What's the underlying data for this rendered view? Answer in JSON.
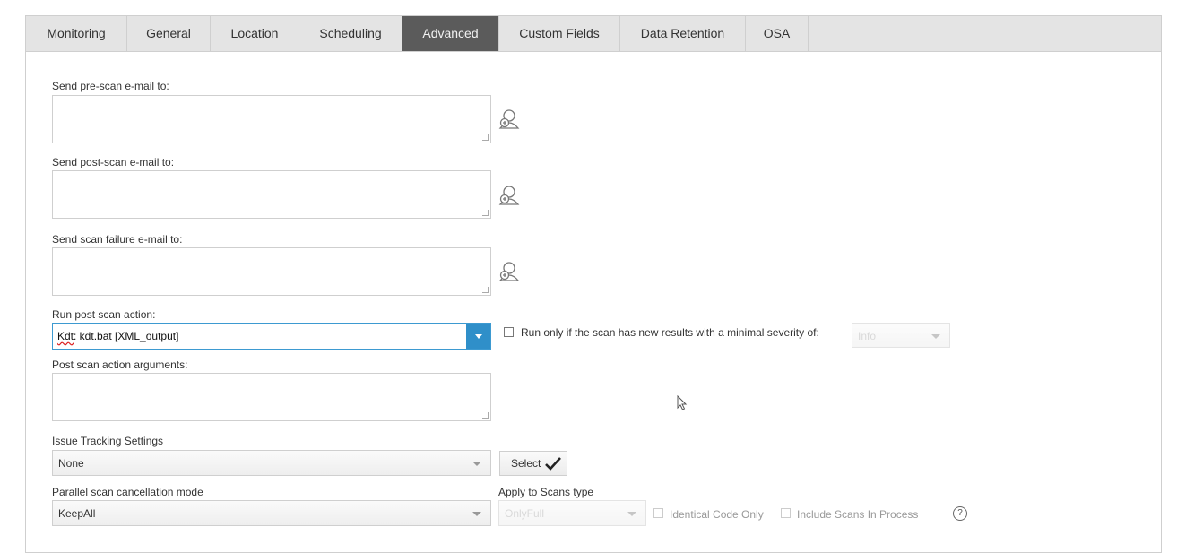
{
  "tabs": [
    {
      "label": "Monitoring",
      "active": false
    },
    {
      "label": "General",
      "active": false
    },
    {
      "label": "Location",
      "active": false
    },
    {
      "label": "Scheduling",
      "active": false
    },
    {
      "label": "Advanced",
      "active": true
    },
    {
      "label": "Custom Fields",
      "active": false
    },
    {
      "label": "Data Retention",
      "active": false
    },
    {
      "label": "OSA",
      "active": false
    }
  ],
  "advanced": {
    "pre_scan_email_label": "Send pre-scan e-mail to:",
    "pre_scan_email_value": "",
    "post_scan_email_label": "Send post-scan e-mail to:",
    "post_scan_email_value": "",
    "failure_email_label": "Send scan failure e-mail to:",
    "failure_email_value": "",
    "post_scan_action_label": "Run post scan action:",
    "post_scan_action_value_prefix": "Kdt",
    "post_scan_action_value_rest": ": kdt.bat [XML_output]",
    "run_only_label": "Run only if the scan has new results with a minimal severity of:",
    "run_only_checked": false,
    "severity_value": "Info",
    "post_scan_args_label": "Post scan action arguments:",
    "post_scan_args_value": "",
    "issue_tracking_label": "Issue Tracking Settings",
    "issue_tracking_value": "None",
    "select_button_label": "Select",
    "parallel_cancel_label": "Parallel scan cancellation mode",
    "parallel_cancel_value": "KeepAll",
    "apply_scans_label": "Apply to Scans type",
    "apply_scans_value": "OnlyFull",
    "identical_code_label": "Identical Code Only",
    "include_in_process_label": "Include Scans In Process",
    "help_glyph": "?"
  },
  "icons": {
    "address_book": "address-book-icon",
    "checkmark": "checkmark-icon",
    "cursor": "mouse-cursor-icon"
  },
  "colors": {
    "active_tab_bg": "#5b5b5b",
    "dropdown_button": "#2f8fc9",
    "focus_border": "#3d9ad1"
  }
}
